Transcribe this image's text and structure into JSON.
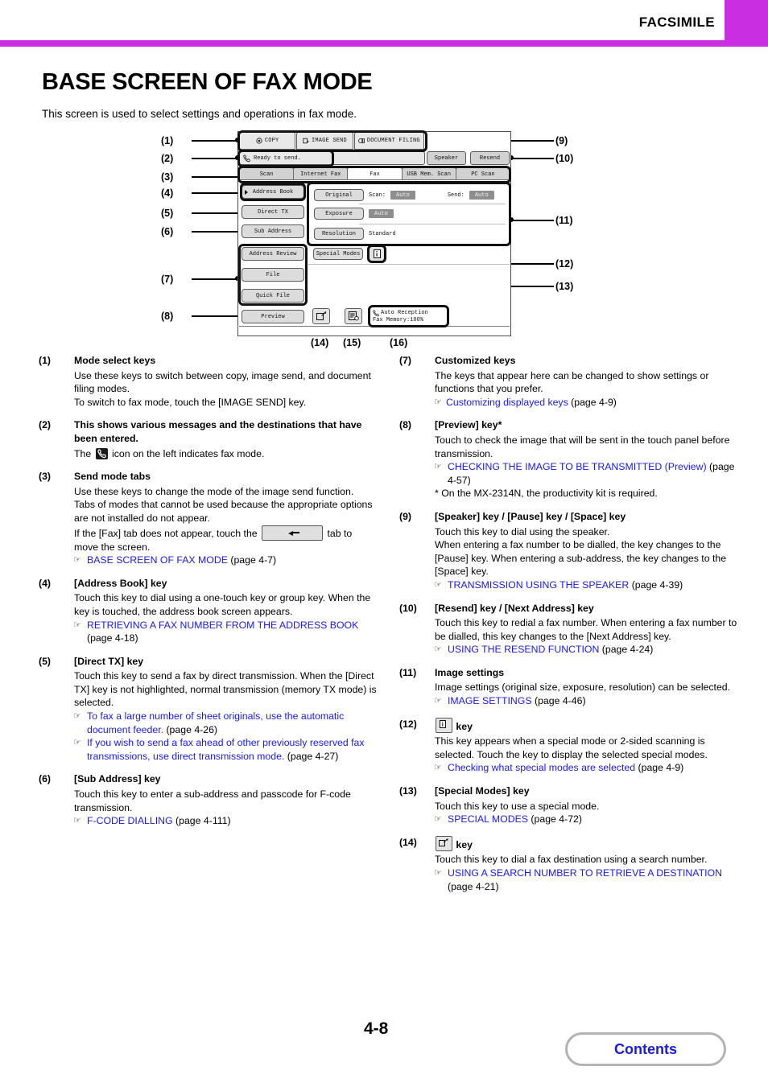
{
  "header": {
    "title": "FACSIMILE",
    "accent_color": "#c92ee0"
  },
  "page": {
    "title": "BASE SCREEN OF FAX MODE",
    "subtitle": "This screen is used to select settings and operations in fax mode.",
    "page_number": "4-8",
    "contents_button": "Contents"
  },
  "diagram": {
    "callouts": [
      "(1)",
      "(2)",
      "(3)",
      "(4)",
      "(5)",
      "(6)",
      "(7)",
      "(8)",
      "(9)",
      "(10)",
      "(11)",
      "(12)",
      "(13)",
      "(14)",
      "(15)",
      "(16)"
    ],
    "mode_keys": [
      {
        "label": "COPY",
        "icon": "copy-icon"
      },
      {
        "label": "IMAGE SEND",
        "icon": "image-send-icon"
      },
      {
        "label": "DOCUMENT FILING",
        "icon": "document-filing-icon"
      }
    ],
    "status_message": "Ready to send.",
    "status_icon": "fax-handset-icon",
    "top_right_keys": [
      "Speaker",
      "Resend"
    ],
    "send_mode_tabs": [
      "Scan",
      "Internet Fax",
      "Fax",
      "USB Mem. Scan",
      "PC Scan"
    ],
    "selected_tab": "Fax",
    "left_keys": [
      "Address Book",
      "Direct TX",
      "Sub Address"
    ],
    "custom_keys": [
      "Address Review",
      "File",
      "Quick File"
    ],
    "preview_key": "Preview",
    "image_settings": [
      {
        "key": "Original",
        "label1": "Scan:",
        "value1": "Auto",
        "label2": "Send:",
        "value2": "Auto"
      },
      {
        "key": "Exposure",
        "label1": "",
        "value1": "Auto",
        "label2": "",
        "value2": ""
      },
      {
        "key": "Resolution",
        "label1": "Standard",
        "value1": "",
        "label2": "",
        "value2": ""
      }
    ],
    "special_modes_key": "Special Modes",
    "info_key_icon": "special-mode-info-icon",
    "search_number_icon": "search-number-icon",
    "address_entry_icon": "address-entry-icon",
    "reception_line1": "Auto Reception",
    "reception_line2": "Fax Memory:100%"
  },
  "items": {
    "i1": {
      "num": "(1)",
      "head": "Mode select keys",
      "body1": "Use these keys to switch between copy, image send, and document filing modes.",
      "body2": "To switch to fax mode, touch the [IMAGE SEND] key."
    },
    "i2": {
      "num": "(2)",
      "head": "This shows various messages and the destinations that have been entered.",
      "body_pre": "The",
      "body_post": "icon on the left indicates fax mode."
    },
    "i3": {
      "num": "(3)",
      "head": "Send mode tabs",
      "body1": "Use these keys to change the mode of the image send function.",
      "body2": "Tabs of modes that cannot be used because the appropriate options are not installed do not appear.",
      "body3_pre": "If the [Fax] tab does not appear, touch the",
      "body3_post": "tab to move the screen.",
      "ref1": "BASE SCREEN OF FAX MODE",
      "ref1_pg": "(page 4-7)"
    },
    "i4": {
      "num": "(4)",
      "head": "[Address Book] key",
      "body1": "Touch this key to dial using a one-touch key or group key. When the key is touched, the address book screen appears.",
      "ref1": "RETRIEVING A FAX NUMBER FROM THE ADDRESS BOOK",
      "ref1_pg": "(page 4-18)"
    },
    "i5": {
      "num": "(5)",
      "head": "[Direct TX] key",
      "body1": "Touch this key to send a fax by direct transmission. When the [Direct TX] key is not highlighted, normal transmission (memory TX mode) is selected.",
      "ref1": "To fax a large number of sheet originals, use the automatic document feeder.",
      "ref1_pg": "(page 4-26)",
      "ref2": "If you wish to send a fax ahead of other previously reserved fax transmissions, use direct transmission mode.",
      "ref2_pg": "(page 4-27)"
    },
    "i6": {
      "num": "(6)",
      "head": "[Sub Address] key",
      "body1": "Touch this key to enter a sub-address and passcode for F-code transmission.",
      "ref1": "F-CODE DIALLING",
      "ref1_pg": "(page 4-111)"
    },
    "i7": {
      "num": "(7)",
      "head": "Customized keys",
      "body1": "The keys that appear here can be changed to show settings or functions that you prefer.",
      "ref1": "Customizing displayed keys",
      "ref1_pg": "(page 4-9)"
    },
    "i8": {
      "num": "(8)",
      "head": "[Preview] key*",
      "body1": "Touch to check the image that will be sent in the touch panel before transmission.",
      "ref1": "CHECKING THE IMAGE TO BE TRANSMITTED (Preview)",
      "ref1_pg": "(page 4-57)",
      "note": "* On the MX-2314N, the productivity kit is required."
    },
    "i9": {
      "num": "(9)",
      "head": "[Speaker] key / [Pause] key / [Space] key",
      "body1": "Touch this key to dial using the speaker.",
      "body2": "When entering a fax number to be dialled, the key changes to the [Pause] key. When entering a sub-address, the key changes to the [Space] key.",
      "ref1": "TRANSMISSION USING THE SPEAKER",
      "ref1_pg": "(page 4-39)"
    },
    "i10": {
      "num": "(10)",
      "head": "[Resend] key / [Next Address] key",
      "body1": "Touch this key to redial a fax number. When entering a fax number to be dialled, this key changes to the [Next Address] key.",
      "ref1": "USING THE RESEND FUNCTION",
      "ref1_pg": "(page 4-24)"
    },
    "i11": {
      "num": "(11)",
      "head": "Image settings",
      "body1": "Image settings (original size, exposure, resolution) can be selected.",
      "ref1": "IMAGE SETTINGS",
      "ref1_pg": "(page 4-46)"
    },
    "i12": {
      "num": "(12)",
      "head_post": "key",
      "body1": "This key appears when a special mode or 2-sided scanning is selected. Touch the key to display the selected special modes.",
      "ref1": "Checking what special modes are selected",
      "ref1_pg": "(page 4-9)"
    },
    "i13": {
      "num": "(13)",
      "head": "[Special Modes] key",
      "body1": "Touch this key to use a special mode.",
      "ref1": "SPECIAL MODES",
      "ref1_pg": "(page 4-72)"
    },
    "i14": {
      "num": "(14)",
      "head_post": "key",
      "body1": "Touch this key to dial a fax destination using a search number.",
      "ref1": "USING A SEARCH NUMBER TO RETRIEVE A DESTINATION",
      "ref1_pg": "(page 4-21)"
    }
  }
}
